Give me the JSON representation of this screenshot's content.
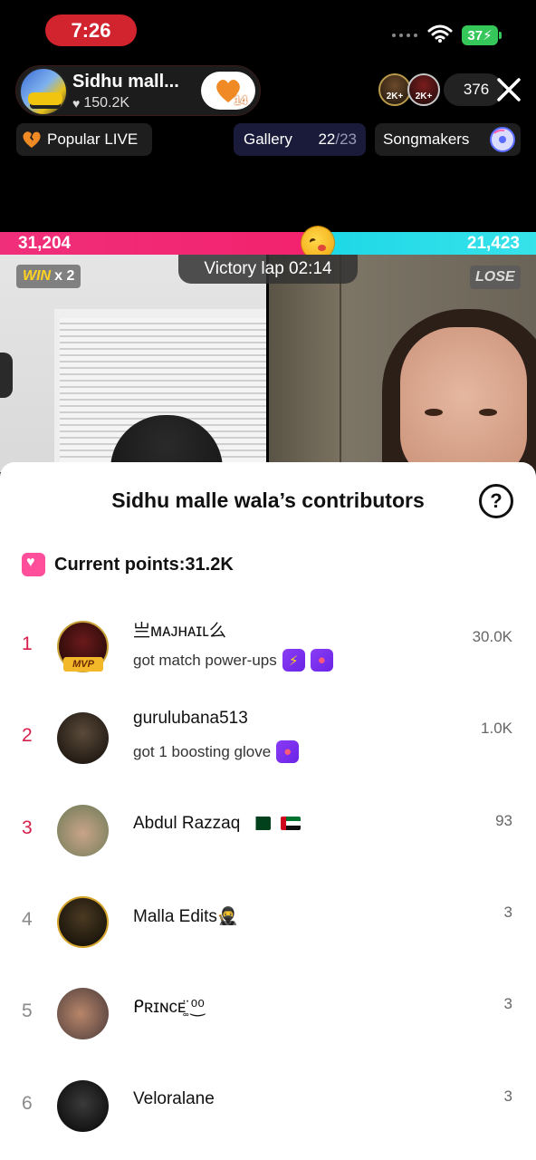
{
  "status_bar": {
    "time": "7:26",
    "battery": "37"
  },
  "host": {
    "name": "Sidhu mall...",
    "likes": "150.2K",
    "follow_count": "14"
  },
  "viewers": {
    "avatar1_badge": "2K+",
    "avatar2_badge": "2K+",
    "count": "376"
  },
  "chips": {
    "popular": "Popular LIVE",
    "gallery": "Gallery",
    "gallery_current": "22",
    "gallery_total": "/23",
    "songmakers": "Songmakers"
  },
  "battle": {
    "score_left": "31,204",
    "score_right": "21,423",
    "victory_text": "Victory lap 02:14",
    "win_label": "WIN",
    "win_multiplier": "x 2",
    "lose_label": "LOSE"
  },
  "sheet": {
    "title": "Sidhu malle wala’s contributors",
    "help": "?",
    "current_points": "Current points:31.2K"
  },
  "contributors": [
    {
      "rank": "1",
      "name": "亗ᴍᴀᴊʜᴀɪʟ么",
      "sub": "got match power-ups",
      "score": "30.0K",
      "badge": "MVP"
    },
    {
      "rank": "2",
      "name": "gurulubana513",
      "sub": "got 1 boosting glove",
      "score": "1.0K"
    },
    {
      "rank": "3",
      "name": "Abdul Razzaq",
      "score": "93"
    },
    {
      "rank": "4",
      "name": "Malla Edits🥷",
      "score": "3"
    },
    {
      "rank": "5",
      "name": "ᑭʀɪɴᴄᴇ͚̈ ⁰͜⁰",
      "score": "3"
    },
    {
      "rank": "6",
      "name": "Veloralane",
      "score": "3"
    }
  ],
  "colors": {
    "accent_pink": "#f3226e",
    "accent_cyan": "#1ed8e6",
    "rank_top": "#d81f4c",
    "time_pill": "#d2242e"
  }
}
